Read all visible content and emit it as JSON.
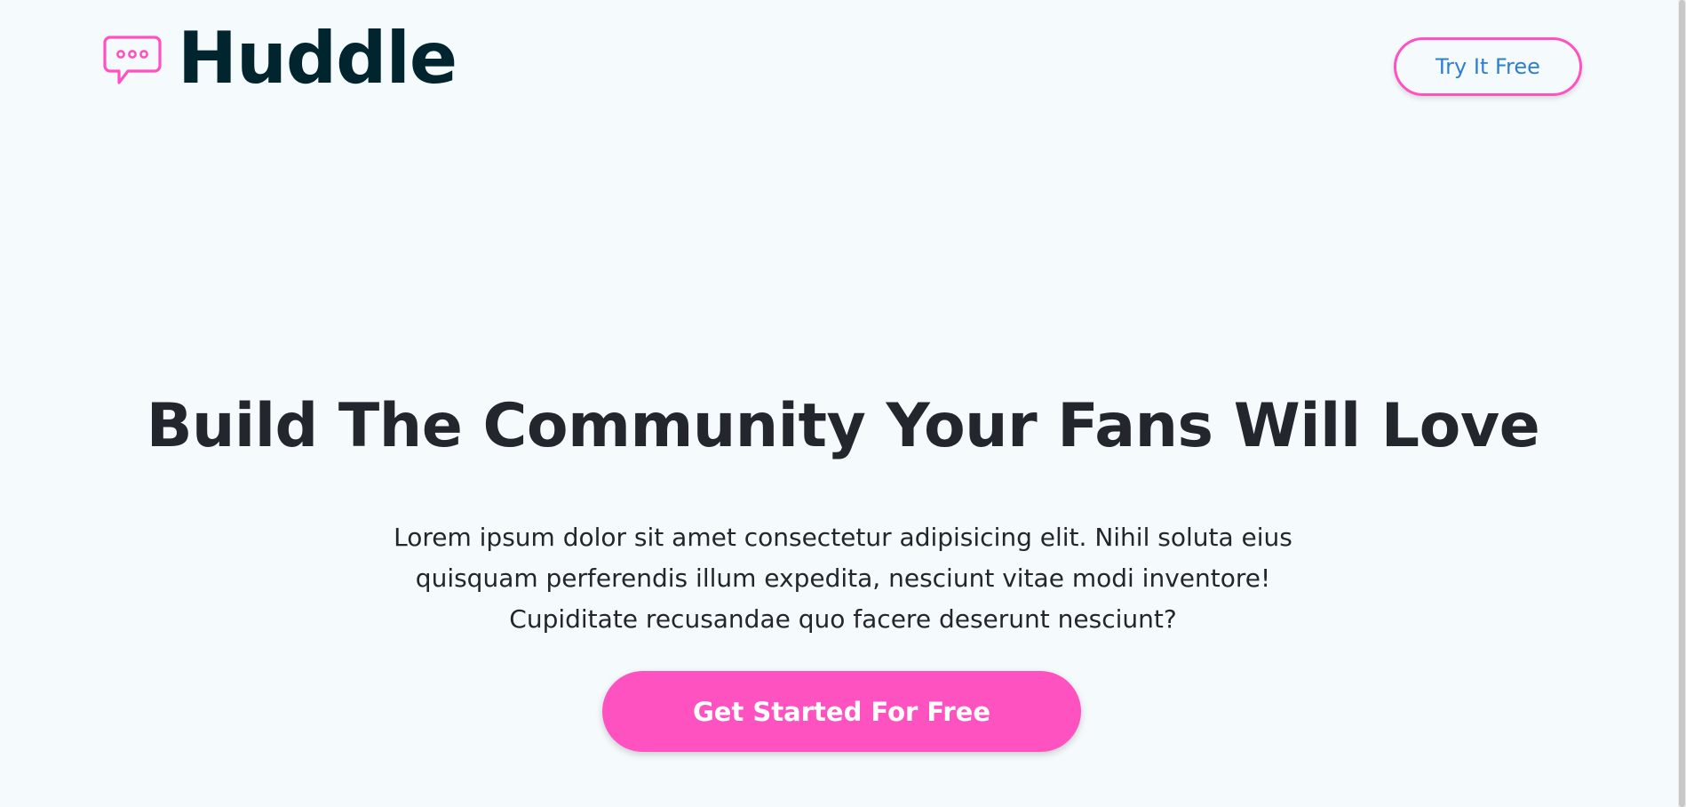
{
  "header": {
    "logo_text": "Huddle",
    "try_button_label": "Try It Free"
  },
  "hero": {
    "title": "Build The Community Your Fans Will Love",
    "description": "Lorem ipsum dolor sit amet consectetur adipisicing elit. Nihil soluta eius quisquam perferendis illum expedita, nesciunt vitae modi inventore! Cupiditate recusandae quo facere deserunt nesciunt?",
    "cta_label": "Get Started For Free"
  },
  "icons": {
    "logo": "chat-bubble-icon"
  },
  "colors": {
    "background": "#f5fafd",
    "brand_pink": "#ff52c1",
    "heading_dark": "#00252e",
    "text_dark": "#23262d",
    "link_blue": "#2e7ed3"
  }
}
